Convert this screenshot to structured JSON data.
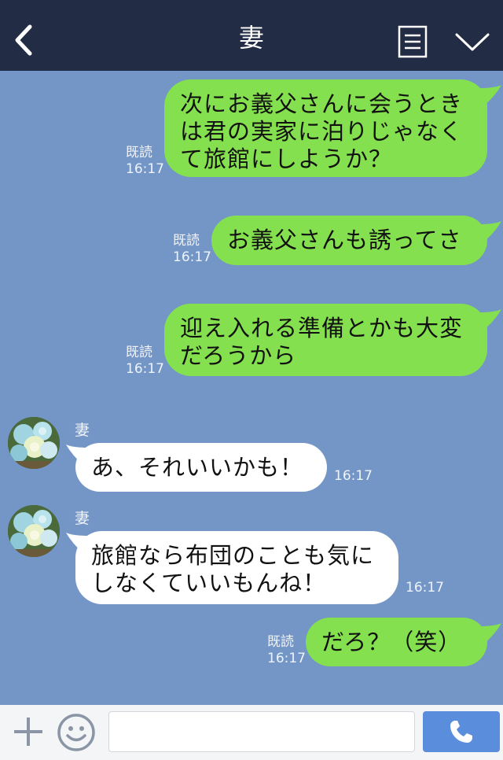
{
  "header": {
    "title": "妻"
  },
  "messages": [
    {
      "side": "right",
      "text": "次にお義父さんに会うとき\nは君の実家に泊りじゃなく\nて旅館にしようか？",
      "read": "既読",
      "time": "16:17"
    },
    {
      "side": "right",
      "text": "お義父さんも誘ってさ",
      "read": "既読",
      "time": "16:17"
    },
    {
      "side": "right",
      "text": "迎え入れる準備とかも大変\nだろうから",
      "read": "既読",
      "time": "16:17"
    },
    {
      "side": "left",
      "sender": "妻",
      "text": "あ、それいいかも！",
      "time": "16:17"
    },
    {
      "side": "left",
      "sender": "妻",
      "text": "旅館なら布団のことも気に\nしなくていいもんね！",
      "time": "16:17"
    },
    {
      "side": "right",
      "text": "だろ？（笑）",
      "read": "既読",
      "time": "16:17"
    }
  ],
  "colors": {
    "background": "#7396c7",
    "header": "#232c45",
    "sent_bubble": "#84e04e",
    "received_bubble": "#ffffff",
    "call_button": "#5a8ddc"
  },
  "icons": {
    "back": "chevron-left-icon",
    "menu": "memo-icon",
    "expand": "chevron-down-icon",
    "add": "plus-icon",
    "sticker": "smiley-icon",
    "call": "phone-icon"
  }
}
